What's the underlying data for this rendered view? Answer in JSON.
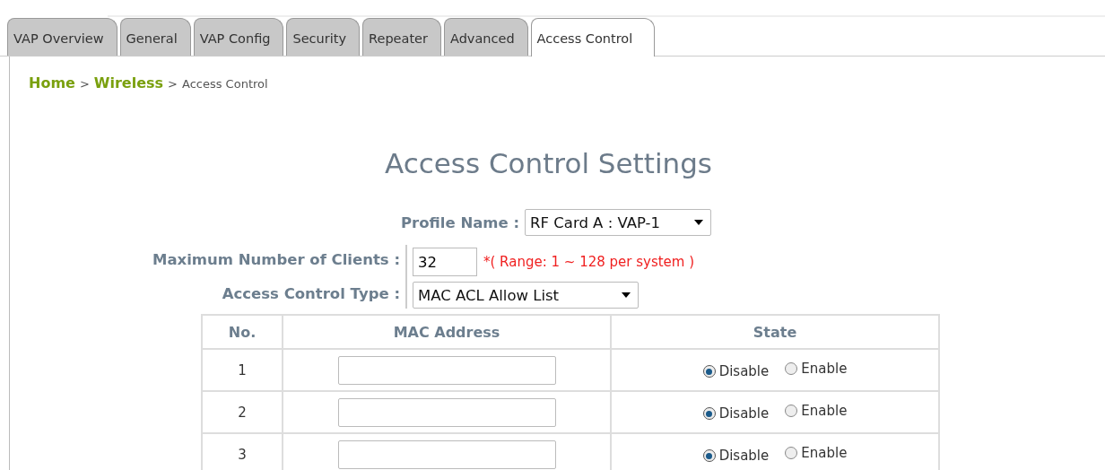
{
  "tabs": [
    {
      "label": "VAP Overview",
      "selected": false
    },
    {
      "label": "General",
      "selected": false
    },
    {
      "label": "VAP Config",
      "selected": false
    },
    {
      "label": "Security",
      "selected": false
    },
    {
      "label": "Repeater",
      "selected": false
    },
    {
      "label": "Advanced",
      "selected": false
    },
    {
      "label": "Access Control",
      "selected": true
    }
  ],
  "breadcrumb": [
    {
      "label": "Home",
      "kind": "link"
    },
    {
      "label": ">",
      "kind": "sep"
    },
    {
      "label": "Wireless",
      "kind": "link"
    },
    {
      "label": ">",
      "kind": "sep"
    },
    {
      "label": "Access Control",
      "kind": "current"
    }
  ],
  "title": "Access Control Settings",
  "profile": {
    "label": "Profile Name :",
    "value": "RF Card A : VAP-1"
  },
  "max_clients": {
    "label": "Maximum Number of Clients :",
    "value": "32",
    "hint": "*( Range: 1 ~ 128 per system )"
  },
  "access_type": {
    "label": "Access Control Type :",
    "value": "MAC ACL Allow List"
  },
  "table": {
    "columns": [
      "No.",
      "MAC Address",
      "State"
    ],
    "rows": [
      {
        "no": "1",
        "options": [
          {
            "label": "Disable",
            "selected": true
          },
          {
            "label": "Enable",
            "selected": false
          }
        ]
      },
      {
        "no": "2",
        "options": [
          {
            "label": "Disable",
            "selected": true
          },
          {
            "label": "Enable",
            "selected": false
          }
        ]
      },
      {
        "no": "3",
        "options": [
          {
            "label": "Disable",
            "selected": true
          },
          {
            "label": "Enable",
            "selected": false
          }
        ]
      }
    ]
  }
}
